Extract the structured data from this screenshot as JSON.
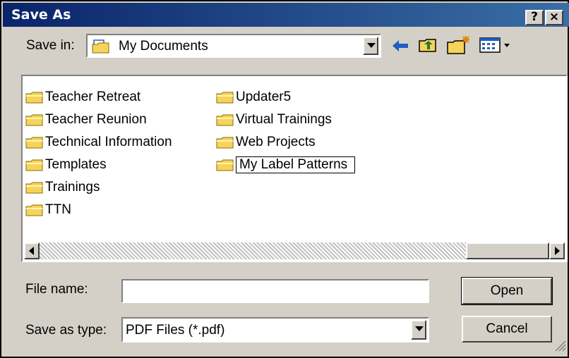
{
  "window": {
    "title": "Save As",
    "help_label": "?",
    "close_label": "×"
  },
  "toolbar": {
    "save_in_label": "Save in:",
    "location": "My Documents",
    "icons": [
      "my-documents-icon",
      "back-arrow-icon",
      "up-one-level-icon",
      "new-folder-icon",
      "view-menu-icon"
    ]
  },
  "file_list": {
    "items": [
      {
        "label": "Teacher Retreat"
      },
      {
        "label": "Teacher Reunion"
      },
      {
        "label": "Technical Information"
      },
      {
        "label": "Templates"
      },
      {
        "label": "Trainings"
      },
      {
        "label": "TTN"
      },
      {
        "label": "Updater5"
      },
      {
        "label": "Virtual Trainings"
      },
      {
        "label": "Web Projects"
      },
      {
        "label": "My Label Patterns"
      }
    ]
  },
  "form": {
    "file_name_label": "File name:",
    "file_name_value": "",
    "save_as_type_label": "Save as type:",
    "save_as_type_value": "PDF Files (*.pdf)"
  },
  "buttons": {
    "open": "Open",
    "cancel": "Cancel"
  },
  "colors": {
    "title_start": "#0a246a",
    "title_end": "#3a6ea5",
    "face": "#d4d0c8",
    "folder": "#f7d35b",
    "accent_arrow": "#1e5fbf"
  }
}
